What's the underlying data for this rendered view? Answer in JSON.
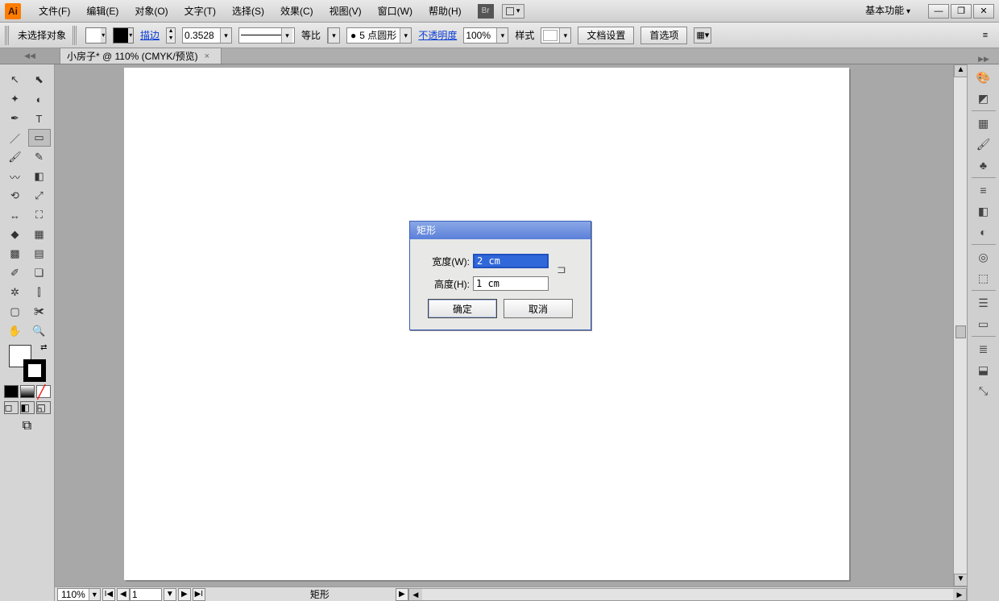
{
  "menu": {
    "items": [
      "文件(F)",
      "编辑(E)",
      "对象(O)",
      "文字(T)",
      "选择(S)",
      "效果(C)",
      "视图(V)",
      "窗口(W)",
      "帮助(H)"
    ],
    "bridge": "Br",
    "workspace": "基本功能"
  },
  "window_controls": {
    "min": "—",
    "max": "❐",
    "close": "✕"
  },
  "options": {
    "no_selection": "未选择对象",
    "fill_color": "#ffffff",
    "stroke_color": "#000000",
    "stroke_label": "描边",
    "stroke_weight": "0.3528",
    "dash_label": "等比",
    "brush_label": "5 点圆形",
    "opacity_label": "不透明度",
    "opacity_value": "100%",
    "style_label": "样式",
    "doc_setup": "文档设置",
    "preferences": "首选项"
  },
  "document": {
    "tab_title": "小房子* @ 110% (CMYK/预览)",
    "tab_close": "×"
  },
  "status": {
    "zoom": "110%",
    "page": "1",
    "tool": "矩形"
  },
  "dialog": {
    "title": "矩形",
    "width_label": "宽度(W):",
    "width_value": "2 cm",
    "height_label": "高度(H):",
    "height_value": "1 cm",
    "ok": "确定",
    "cancel": "取消"
  },
  "toolbox": {
    "tools": [
      [
        "selection",
        "↖"
      ],
      [
        "direct-selection",
        "⬉"
      ],
      [
        "magic-wand",
        "✦"
      ],
      [
        "lasso",
        "◐"
      ],
      [
        "pen",
        "✒"
      ],
      [
        "type",
        "T"
      ],
      [
        "line",
        "／"
      ],
      [
        "rectangle",
        "▭"
      ],
      [
        "paintbrush",
        "🖌"
      ],
      [
        "pencil",
        "✎"
      ],
      [
        "blob-brush",
        "〰"
      ],
      [
        "eraser",
        "◧"
      ],
      [
        "rotate",
        "⟲"
      ],
      [
        "scale",
        "⤢"
      ],
      [
        "width",
        "↔"
      ],
      [
        "free-transform",
        "⛶"
      ],
      [
        "shape-builder",
        "◆"
      ],
      [
        "perspective",
        "▦"
      ],
      [
        "mesh",
        "▩"
      ],
      [
        "gradient",
        "▤"
      ],
      [
        "eyedropper",
        "✐"
      ],
      [
        "blend",
        "❏"
      ],
      [
        "symbol-sprayer",
        "✲"
      ],
      [
        "graph",
        "⫿"
      ],
      [
        "artboard",
        "▢"
      ],
      [
        "slice",
        "✀"
      ],
      [
        "hand",
        "✋"
      ],
      [
        "zoom",
        "🔍"
      ]
    ],
    "selected": "rectangle"
  },
  "dock_icons": [
    "color",
    "color-guide",
    "",
    "swatches",
    "brushes",
    "symbols",
    "",
    "stroke",
    "gradient",
    "transparency",
    "",
    "appearance",
    "graphic-styles",
    "",
    "layers",
    "artboards",
    "",
    "align",
    "pathfinder",
    "transform"
  ]
}
